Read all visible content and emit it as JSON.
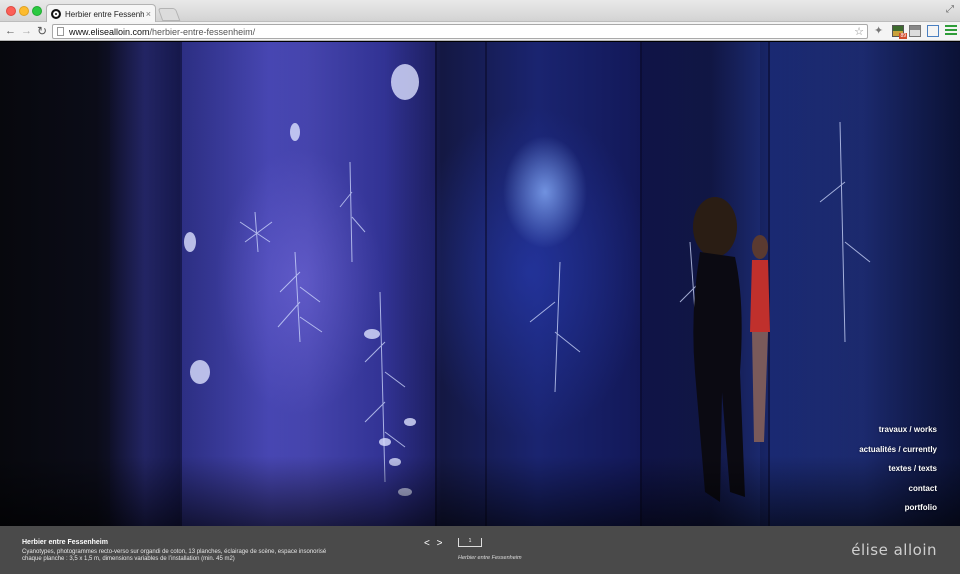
{
  "browser": {
    "tab_title": "Herbier entre Fessenheim",
    "tab_close": "×",
    "url_domain": "www.elisealloin.com",
    "url_path": "/herbier-entre-fessenheim/",
    "ext_badge": "89"
  },
  "nav": {
    "items": [
      {
        "label": "travaux / works"
      },
      {
        "label": "actualités / currently"
      },
      {
        "label": "textes / texts"
      },
      {
        "label": "contact"
      },
      {
        "label": "portfolio"
      }
    ]
  },
  "caption": {
    "title": "Herbier entre Fessenheim",
    "description_line1": "Cyanotypes, photogrammes recto-verso sur organdi de coton, 13 planches, éclairage de scène, espace insonorisé",
    "description_line2": "chaque planche : 3,5 x 1,5 m, dimensions variables de l’installation (min. 45 m2)",
    "pager": "< >",
    "thumb_index": "1",
    "thumb_caption": "Herbier entre Fessenheim"
  },
  "brand": "élise alloin"
}
